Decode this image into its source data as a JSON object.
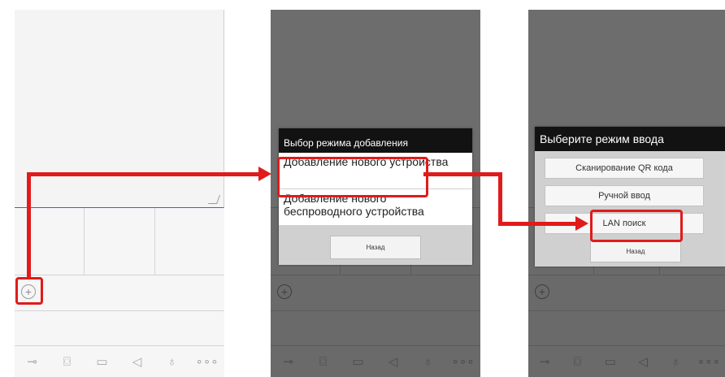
{
  "panel1": {
    "toolbar_icons": [
      "key-icon",
      "camera-icon",
      "video-record-icon",
      "speaker-icon",
      "microphone-icon",
      "more-icon"
    ]
  },
  "panel2": {
    "dialog_title": "Выбор режима добавления",
    "option_new_device": "Добавление нового устройства",
    "option_wireless_device": "Добавление нового беспроводного устройства",
    "back_button": "Назад"
  },
  "panel3": {
    "dialog_title": "Выберите режим ввода",
    "qr_scan": "Сканирование QR кода",
    "manual_entry": "Ручной ввод",
    "lan_search": "LAN поиск",
    "back_button": "Назад"
  },
  "colors": {
    "highlight": "#e01b1b",
    "accent_line": "#2f6fb6",
    "dialog_title_bg": "#121212"
  }
}
